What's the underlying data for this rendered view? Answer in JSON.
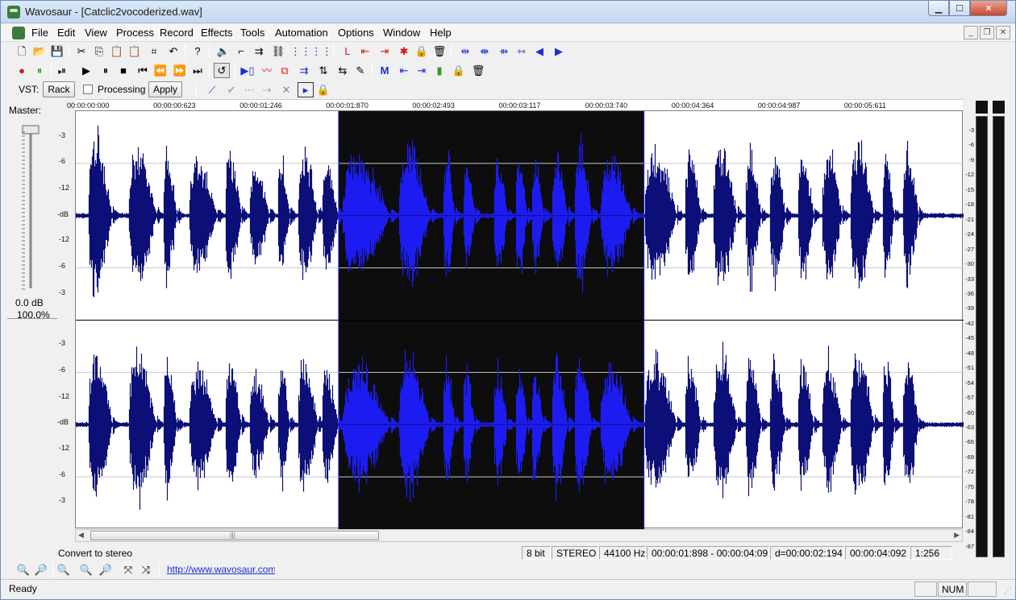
{
  "window": {
    "app_name": "Wavosaur",
    "document": "[Catclic2vocoderized.wav]",
    "min_glyph": "▁",
    "max_glyph": "☐",
    "close_glyph": "✕"
  },
  "menu": {
    "items": [
      "File",
      "Edit",
      "View",
      "Process",
      "Record",
      "Effects",
      "Tools",
      "Automation",
      "Options",
      "Window",
      "Help"
    ],
    "mdi": [
      "_",
      "❐",
      "✕"
    ]
  },
  "vst": {
    "label": "VST:",
    "rack": "Rack",
    "processing": "Processing",
    "apply": "Apply"
  },
  "master": {
    "label": "Master:",
    "db": "0.0 dB",
    "percent": "100.0%",
    "level": 1.0
  },
  "timeline": {
    "labels": [
      "00:00:00:000",
      "00:00:00:623",
      "00:00:01:246",
      "00:00:01:870",
      "00:00:02:493",
      "00:00:03:117",
      "00:00:03:740",
      "00:00:04:364",
      "00:00:04:987",
      "00:00:05:611"
    ]
  },
  "channels": {
    "db_labels": [
      "-3",
      "-6",
      "-12",
      "-dB",
      "-12",
      "-6",
      "-3"
    ]
  },
  "selection": {
    "start_fraction": 0.296,
    "end_fraction": 0.64
  },
  "colors": {
    "wave": "#0b0f77",
    "wave_selected": "#1c1cf2",
    "selection_bg": "#0d0d0d",
    "icon_blue": "#1a2fd0",
    "icon_red": "#d21a1a",
    "icon_green": "#2a9d2a"
  },
  "vu": {
    "labels": [
      "-3",
      "-6",
      "-9",
      "-12",
      "-15",
      "-18",
      "-21",
      "-24",
      "-27",
      "-30",
      "-33",
      "-36",
      "-39",
      "-42",
      "-45",
      "-48",
      "-51",
      "-54",
      "-57",
      "-60",
      "-63",
      "-66",
      "-69",
      "-72",
      "-75",
      "-78",
      "-81",
      "-84",
      "-87"
    ]
  },
  "status": {
    "hint": "Convert to stereo",
    "bits": "8 bit",
    "mode": "STEREO",
    "rate": "44100 Hz",
    "range": "00:00:01:898 - 00:00:04:092",
    "duration": "d=00:00:02:194",
    "end": "00:00:04:092",
    "zoom": "1:256",
    "link": "http://www.wavosaur.com",
    "ready": "Ready",
    "num": "NUM"
  }
}
